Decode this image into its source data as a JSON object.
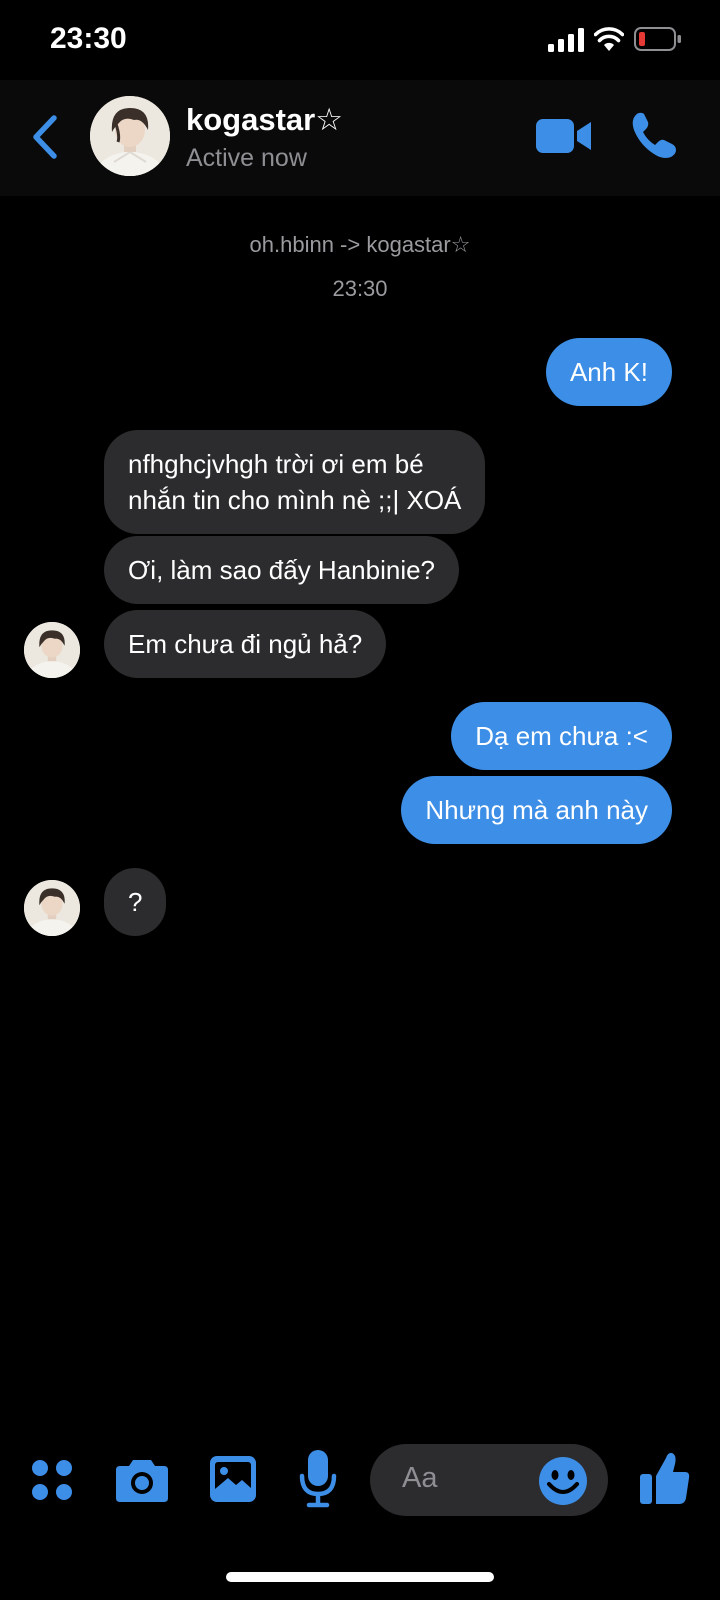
{
  "status_bar": {
    "time": "23:30",
    "icons": [
      "signal-icon",
      "wifi-icon",
      "battery-icon"
    ]
  },
  "header": {
    "contact_name": "kogastar☆",
    "contact_status": "Active now",
    "icons": [
      "back-arrow-icon",
      "video-camera-icon",
      "phone-icon"
    ]
  },
  "chat": {
    "nickname_notice": "oh.hbinn -> kogastar☆",
    "timestamp": "23:30",
    "messages": [
      {
        "from": "me",
        "text": "Anh K!"
      },
      {
        "from": "them",
        "lines": [
          "nfhghcjvhgh trời ơi em bé",
          "nhắn tin cho mình nè ;;| XOÁ"
        ]
      },
      {
        "from": "them",
        "text": "Ơi, làm sao đấy Hanbinie?"
      },
      {
        "from": "them",
        "text": "Em chưa đi ngủ hả?"
      },
      {
        "from": "me",
        "text": "Dạ em chưa :<"
      },
      {
        "from": "me",
        "text": "Nhưng mà anh này"
      },
      {
        "from": "them",
        "text": "?"
      }
    ]
  },
  "composer": {
    "placeholder": "Aa",
    "icons": [
      "apps-grid-icon",
      "camera-icon",
      "image-icon",
      "microphone-icon",
      "emoji-icon",
      "thumbs-up-icon"
    ]
  },
  "colors": {
    "accent": "#3d8ee6",
    "incoming_bubble": "#2c2c2e",
    "background": "#000000",
    "secondary_text": "#8e8e93",
    "battery_low": "#e53935"
  }
}
